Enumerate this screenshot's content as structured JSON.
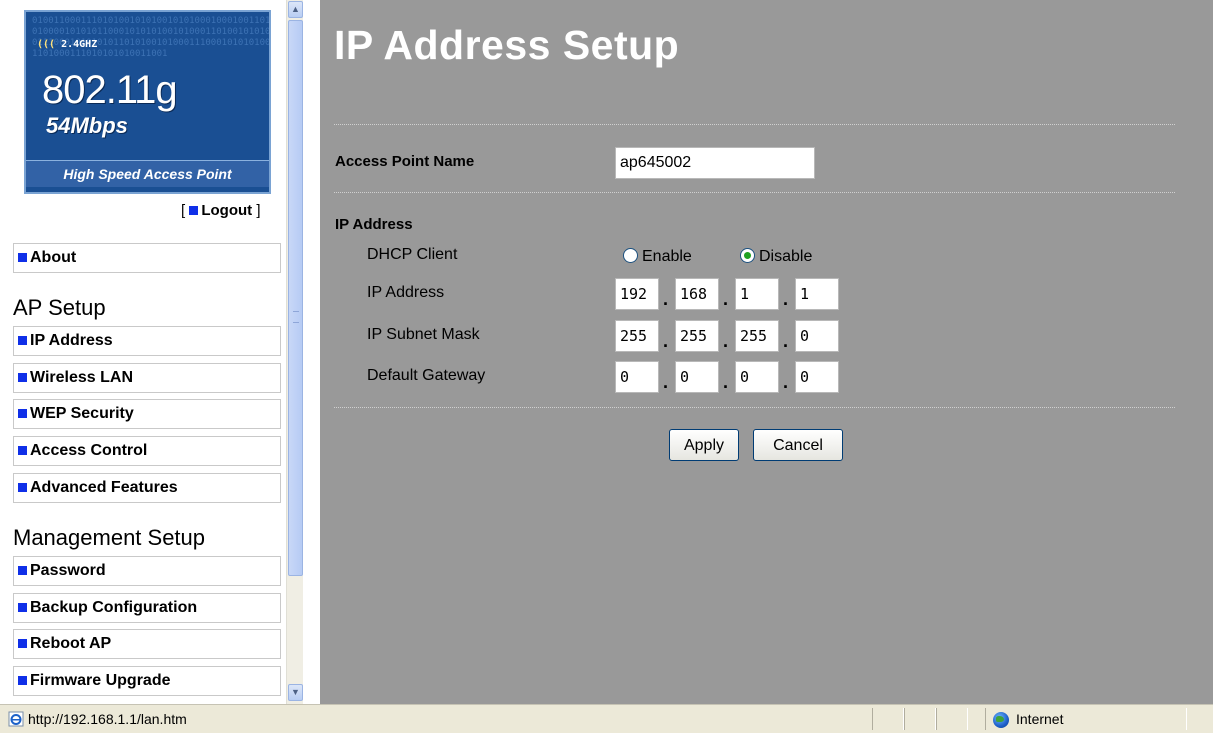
{
  "logo": {
    "bits": "0100110001110101001010100101010001000100110101000010101011000101010100101000110100101010011100010101010110101001010001110001010101001101000111010101010011001",
    "band_prefix": "(((",
    "band": "2.4GHZ",
    "model": "802.11g",
    "speed": "54Mbps",
    "tagline": "High Speed Access Point"
  },
  "logout": {
    "open": "[",
    "label": "Logout",
    "close": "]"
  },
  "sidebar": {
    "about": "About",
    "ap_setup_heading": "AP Setup",
    "ap_items": [
      "IP Address",
      "Wireless LAN",
      "WEP Security",
      "Access Control",
      "Advanced Features"
    ],
    "management_heading": "Management Setup",
    "mgmt_items": [
      "Password",
      "Backup Configuration",
      "Reboot AP",
      "Firmware Upgrade"
    ]
  },
  "main": {
    "title": "IP Address Setup",
    "ap_name_label": "Access Point Name",
    "ap_name_value": "ap645002",
    "ip_section_label": "IP Address",
    "dhcp_label": "DHCP Client",
    "dhcp_enable": "Enable",
    "dhcp_disable": "Disable",
    "dhcp_selected": "Disable",
    "ip_label": "IP Address",
    "ip": [
      "192",
      "168",
      "1",
      "1"
    ],
    "mask_label": "IP Subnet Mask",
    "mask": [
      "255",
      "255",
      "255",
      "0"
    ],
    "gateway_label": "Default Gateway",
    "gateway": [
      "0",
      "0",
      "0",
      "0"
    ],
    "apply": "Apply",
    "cancel": "Cancel"
  },
  "statusbar": {
    "url": "http://192.168.1.1/lan.htm",
    "zone": "Internet"
  },
  "colors": {
    "main_bg": "#999999",
    "bullet": "#0f2fe8",
    "logo_bg": "#1a4f93"
  },
  "icons": {
    "scroll_up": "scroll-up-arrow-icon",
    "scroll_down": "scroll-down-arrow-icon",
    "ie": "internet-explorer-page-icon",
    "zone": "globe-icon"
  }
}
